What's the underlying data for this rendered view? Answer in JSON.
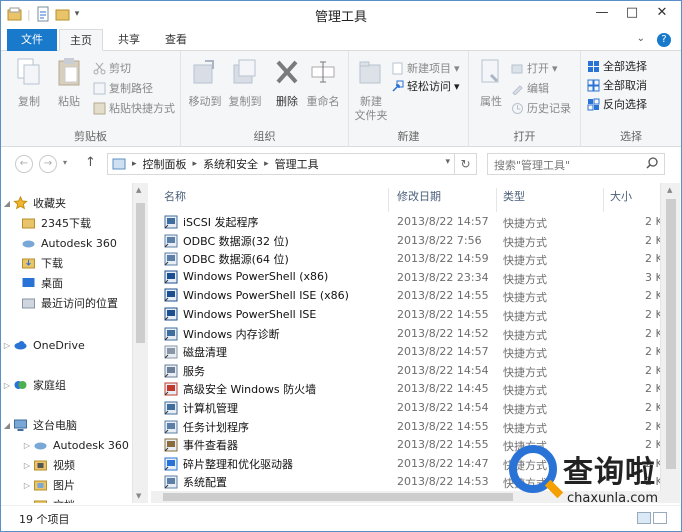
{
  "window": {
    "title": "管理工具",
    "controls": [
      "—",
      "□",
      "✕"
    ]
  },
  "tabs": {
    "file": "文件",
    "home": "主页",
    "share": "共享",
    "view": "查看",
    "help": "?"
  },
  "ribbon": {
    "clipboard": {
      "label": "剪贴板",
      "copy": "复制",
      "paste": "粘贴",
      "cut": "剪切",
      "copy_path": "复制路径",
      "paste_shortcut": "粘贴快捷方式"
    },
    "organize": {
      "label": "组织",
      "move_to": "移动到",
      "copy_to": "复制到",
      "delete": "删除",
      "rename": "重命名"
    },
    "new": {
      "label": "新建",
      "new_folder_line1": "新建",
      "new_folder_line2": "文件夹",
      "new_item": "新建项目",
      "easy_access": "轻松访问"
    },
    "open": {
      "label": "打开",
      "properties": "属性",
      "open": "打开",
      "edit": "编辑",
      "history": "历史记录"
    },
    "select": {
      "label": "选择",
      "select_all": "全部选择",
      "select_none": "全部取消",
      "invert": "反向选择"
    }
  },
  "address": {
    "crumbs": [
      "控制面板",
      "系统和安全",
      "管理工具"
    ],
    "search_placeholder": "搜索\"管理工具\""
  },
  "nav": {
    "favorites": "收藏夹",
    "fav_items": [
      "2345下载",
      "Autodesk 360",
      "下载",
      "桌面",
      "最近访问的位置"
    ],
    "onedrive": "OneDrive",
    "homegroup": "家庭组",
    "thispc": "这台电脑",
    "pc_items": [
      "Autodesk 360",
      "视频",
      "图片",
      "文档"
    ]
  },
  "columns": {
    "name": "名称",
    "date": "修改日期",
    "type": "类型",
    "size": "大小"
  },
  "files": [
    {
      "name": "iSCSI 发起程序",
      "date": "2013/8/22 14:57",
      "type": "快捷方式",
      "size": "2 K"
    },
    {
      "name": "ODBC 数据源(32 位)",
      "date": "2013/8/22 7:56",
      "type": "快捷方式",
      "size": "2 K"
    },
    {
      "name": "ODBC 数据源(64 位)",
      "date": "2013/8/22 14:59",
      "type": "快捷方式",
      "size": "2 K"
    },
    {
      "name": "Windows PowerShell (x86)",
      "date": "2013/8/22 23:34",
      "type": "快捷方式",
      "size": "3 K"
    },
    {
      "name": "Windows PowerShell ISE (x86)",
      "date": "2013/8/22 14:55",
      "type": "快捷方式",
      "size": "2 K"
    },
    {
      "name": "Windows PowerShell ISE",
      "date": "2013/8/22 14:55",
      "type": "快捷方式",
      "size": "2 K"
    },
    {
      "name": "Windows 内存诊断",
      "date": "2013/8/22 14:52",
      "type": "快捷方式",
      "size": "2 K"
    },
    {
      "name": "磁盘清理",
      "date": "2013/8/22 14:57",
      "type": "快捷方式",
      "size": "2 K"
    },
    {
      "name": "服务",
      "date": "2013/8/22 14:54",
      "type": "快捷方式",
      "size": "2 K"
    },
    {
      "name": "高级安全 Windows 防火墙",
      "date": "2013/8/22 14:45",
      "type": "快捷方式",
      "size": "2 K"
    },
    {
      "name": "计算机管理",
      "date": "2013/8/22 14:54",
      "type": "快捷方式",
      "size": "2 K"
    },
    {
      "name": "任务计划程序",
      "date": "2013/8/22 14:55",
      "type": "快捷方式",
      "size": "2 K"
    },
    {
      "name": "事件查看器",
      "date": "2013/8/22 14:55",
      "type": "快捷方式",
      "size": "2 K"
    },
    {
      "name": "碎片整理和优化驱动器",
      "date": "2013/8/22 14:47",
      "type": "快捷方式",
      "size": "2 K"
    },
    {
      "name": "系统配置",
      "date": "2013/8/22 14:53",
      "type": "快捷方式",
      "size": "2 K"
    }
  ],
  "status": {
    "count": "19 个项目"
  },
  "watermark": {
    "cn": "查询啦",
    "en": "chaxunla.com"
  },
  "colors": {
    "accent": "#1979ca",
    "watermark_blue": "#2a73d6",
    "watermark_orange": "#f4a000"
  }
}
